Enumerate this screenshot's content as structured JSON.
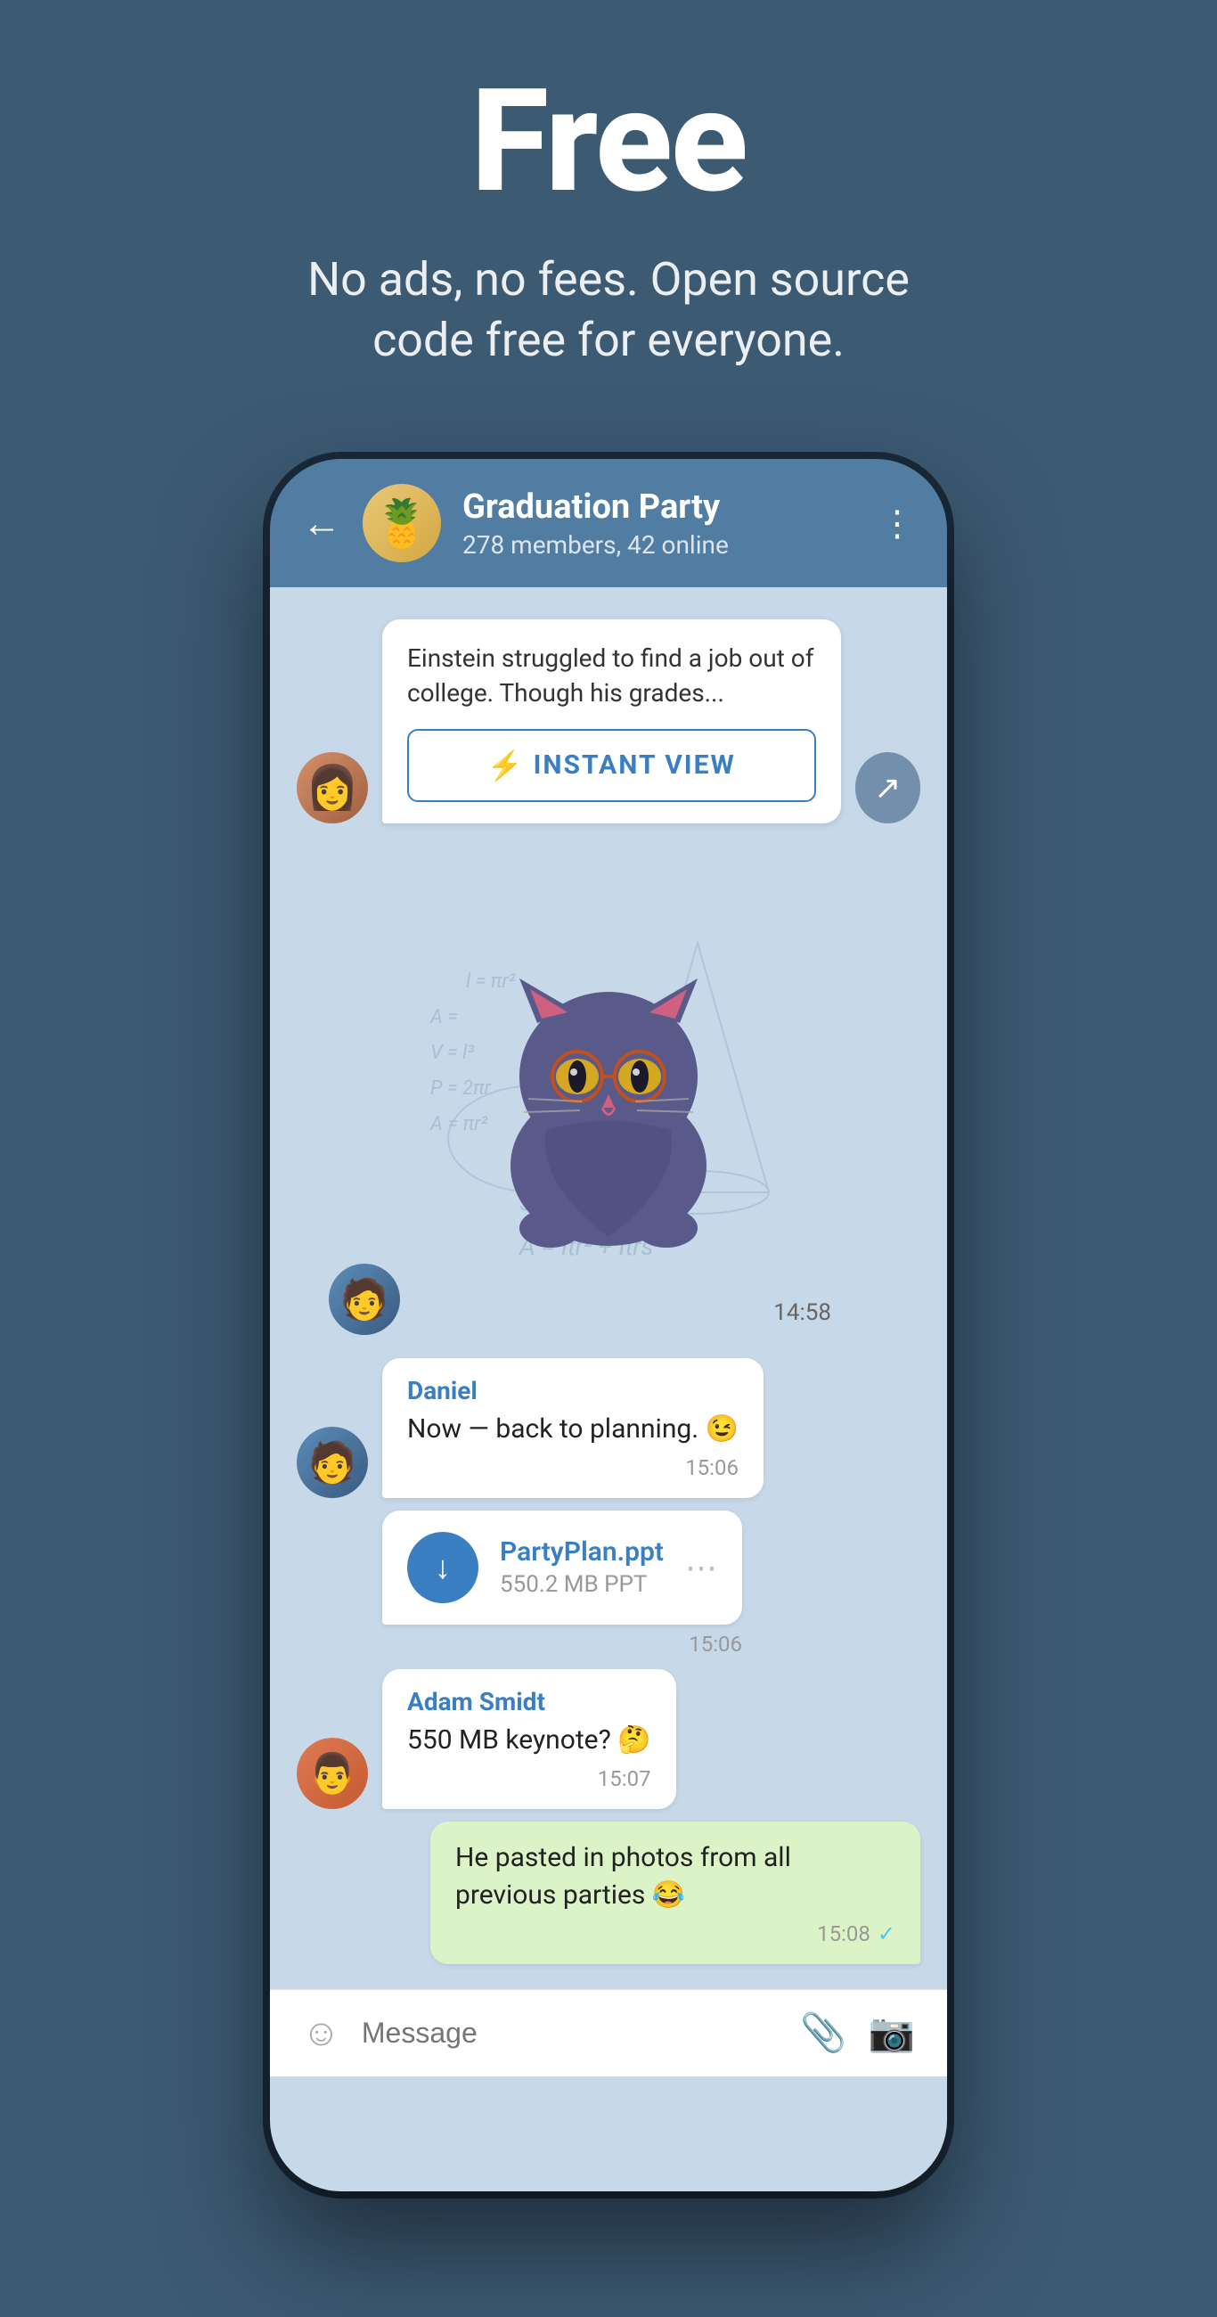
{
  "hero": {
    "title": "Free",
    "subtitle": "No ads, no fees. Open source code free for everyone."
  },
  "chat": {
    "back_label": "←",
    "group_name": "Graduation Party",
    "group_members": "278 members, 42 online",
    "more_icon": "⋮",
    "group_emoji": "🍍"
  },
  "messages": {
    "link_preview_text": "Einstein struggled to find a job out of college. Though his grades...",
    "instant_view_label": "INSTANT VIEW",
    "sticker_time": "14:58",
    "msg1_sender": "Daniel",
    "msg1_text": "Now — back to planning. 😉",
    "msg1_time": "15:06",
    "file_name": "PartyPlan.ppt",
    "file_size": "550.2 MB PPT",
    "file_time": "15:06",
    "msg2_sender": "Adam Smidt",
    "msg2_text": "550 MB keynote? 🤔",
    "msg2_time": "15:07",
    "msg3_text": "He pasted in photos from all previous parties 😂",
    "msg3_time": "15:08"
  },
  "input_bar": {
    "placeholder": "Message",
    "emoji_icon": "☺",
    "attach_icon": "📎",
    "camera_icon": "📷"
  }
}
